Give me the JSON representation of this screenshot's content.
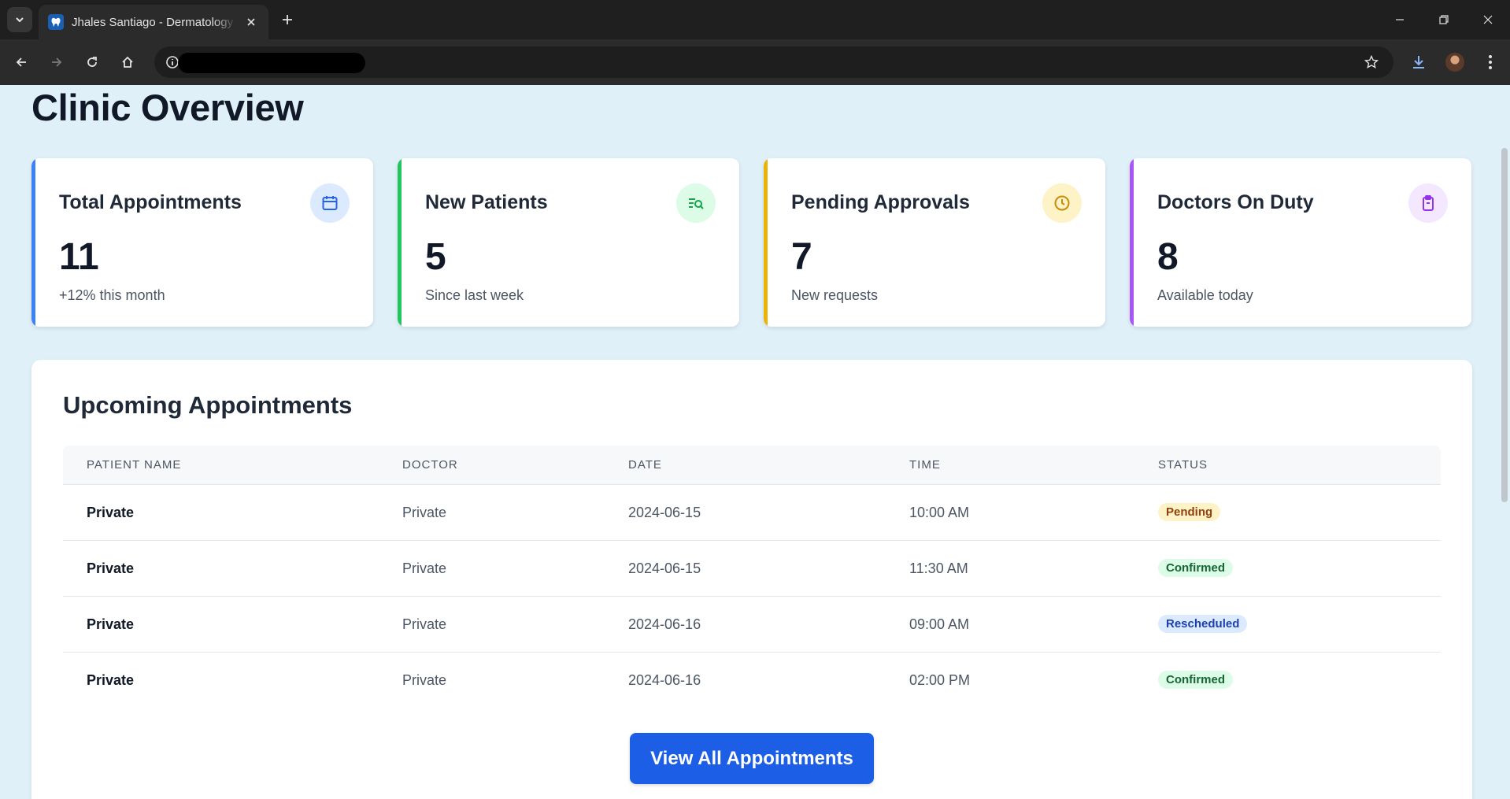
{
  "browser": {
    "tab_title": "Jhales Santiago - Dermatology Clinic",
    "icons": [
      "tab-search-icon",
      "tooth-favicon-icon",
      "close-icon",
      "plus-icon",
      "minimize-icon",
      "restore-icon",
      "close-window-icon",
      "back-icon",
      "forward-icon",
      "reload-icon",
      "home-icon",
      "site-info-icon",
      "star-icon",
      "download-icon",
      "profile-avatar",
      "kebab-menu-icon"
    ]
  },
  "page": {
    "title": "Clinic Overview"
  },
  "stats": [
    {
      "label": "Total Appointments",
      "value": "11",
      "sub": "+12% this month",
      "accent": "#3b82f6",
      "icon": "calendar-icon",
      "icon_bg": "#dbeafe",
      "icon_color": "#2563eb"
    },
    {
      "label": "New Patients",
      "value": "5",
      "sub": "Since last week",
      "accent": "#22c55e",
      "icon": "user-search-icon",
      "icon_bg": "#dcfce7",
      "icon_color": "#16a34a"
    },
    {
      "label": "Pending Approvals",
      "value": "7",
      "sub": "New requests",
      "accent": "#eab308",
      "icon": "clock-icon",
      "icon_bg": "#fef3c7",
      "icon_color": "#ca8a04"
    },
    {
      "label": "Doctors On Duty",
      "value": "8",
      "sub": "Available today",
      "accent": "#a855f7",
      "icon": "clipboard-icon",
      "icon_bg": "#f3e8ff",
      "icon_color": "#9333ea"
    }
  ],
  "appointments": {
    "title": "Upcoming Appointments",
    "columns": [
      "Patient Name",
      "Doctor",
      "Date",
      "Time",
      "Status"
    ],
    "rows": [
      {
        "patient": "Private",
        "doctor": "Private",
        "date": "2024-06-15",
        "time": "10:00 AM",
        "status": "Pending"
      },
      {
        "patient": "Private",
        "doctor": "Private",
        "date": "2024-06-15",
        "time": "11:30 AM",
        "status": "Confirmed"
      },
      {
        "patient": "Private",
        "doctor": "Private",
        "date": "2024-06-16",
        "time": "09:00 AM",
        "status": "Rescheduled"
      },
      {
        "patient": "Private",
        "doctor": "Private",
        "date": "2024-06-16",
        "time": "02:00 PM",
        "status": "Confirmed"
      }
    ],
    "status_colors": {
      "Pending": {
        "bg": "#fef3c7",
        "fg": "#92400e"
      },
      "Confirmed": {
        "bg": "#dcfce7",
        "fg": "#166534"
      },
      "Rescheduled": {
        "bg": "#dbeafe",
        "fg": "#1e40af"
      }
    },
    "view_all_label": "View All Appointments"
  }
}
